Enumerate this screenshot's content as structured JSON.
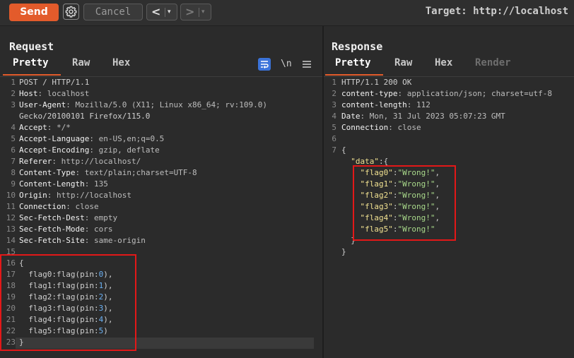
{
  "toolbar": {
    "send_label": "Send",
    "cancel_label": "Cancel",
    "back_glyph": "<",
    "forward_glyph": ">",
    "dropdown_glyph": "▾",
    "target_label": "Target: http://localhost"
  },
  "request": {
    "title": "Request",
    "tabs": [
      "Pretty",
      "Raw",
      "Hex"
    ],
    "newline_toggle": "\\n",
    "lines": [
      {
        "num": "1",
        "key": "",
        "sep": "",
        "value": "POST / HTTP/1.1"
      },
      {
        "num": "2",
        "key": "Host",
        "sep": ": ",
        "value": "localhost"
      },
      {
        "num": "3",
        "key": "User-Agent",
        "sep": ": ",
        "value": "Mozilla/5.0 (X11; Linux x86_64; rv:109.0)"
      },
      {
        "num": "",
        "key": "",
        "sep": "",
        "value": "Gecko/20100101 Firefox/115.0"
      },
      {
        "num": "4",
        "key": "Accept",
        "sep": ": ",
        "value": "*/*"
      },
      {
        "num": "5",
        "key": "Accept-Language",
        "sep": ": ",
        "value": "en-US,en;q=0.5"
      },
      {
        "num": "6",
        "key": "Accept-Encoding",
        "sep": ": ",
        "value": "gzip, deflate"
      },
      {
        "num": "7",
        "key": "Referer",
        "sep": ": ",
        "value": "http://localhost/"
      },
      {
        "num": "8",
        "key": "Content-Type",
        "sep": ": ",
        "value": "text/plain;charset=UTF-8"
      },
      {
        "num": "9",
        "key": "Content-Length",
        "sep": ": ",
        "value": "135"
      },
      {
        "num": "10",
        "key": "Origin",
        "sep": ": ",
        "value": "http://localhost"
      },
      {
        "num": "11",
        "key": "Connection",
        "sep": ": ",
        "value": "close"
      },
      {
        "num": "12",
        "key": "Sec-Fetch-Dest",
        "sep": ": ",
        "value": "empty"
      },
      {
        "num": "13",
        "key": "Sec-Fetch-Mode",
        "sep": ": ",
        "value": "cors"
      },
      {
        "num": "14",
        "key": "Sec-Fetch-Site",
        "sep": ": ",
        "value": "same-origin"
      },
      {
        "num": "15",
        "key": "",
        "sep": "",
        "value": ""
      },
      {
        "num": "16",
        "key": "",
        "sep": "",
        "value": "{"
      },
      {
        "num": "17",
        "key": "",
        "sep": "",
        "value": "  flag0:flag(pin:",
        "n": "0",
        "end": "),"
      },
      {
        "num": "18",
        "key": "",
        "sep": "",
        "value": "  flag1:flag(pin:",
        "n": "1",
        "end": "),"
      },
      {
        "num": "19",
        "key": "",
        "sep": "",
        "value": "  flag2:flag(pin:",
        "n": "2",
        "end": "),"
      },
      {
        "num": "20",
        "key": "",
        "sep": "",
        "value": "  flag3:flag(pin:",
        "n": "3",
        "end": "),"
      },
      {
        "num": "21",
        "key": "",
        "sep": "",
        "value": "  flag4:flag(pin:",
        "n": "4",
        "end": "),"
      },
      {
        "num": "22",
        "key": "",
        "sep": "",
        "value": "  flag5:flag(pin:",
        "n": "5",
        "end": ")"
      },
      {
        "num": "23",
        "key": "",
        "sep": "",
        "value": "}"
      }
    ]
  },
  "response": {
    "title": "Response",
    "tabs": [
      "Pretty",
      "Raw",
      "Hex",
      "Render"
    ],
    "lines": [
      {
        "num": "1",
        "key": "",
        "sep": "",
        "value": "HTTP/1.1 200 OK"
      },
      {
        "num": "2",
        "key": "content-type",
        "sep": ": ",
        "value": "application/json; charset=utf-8"
      },
      {
        "num": "3",
        "key": "content-length",
        "sep": ": ",
        "value": "112"
      },
      {
        "num": "4",
        "key": "Date",
        "sep": ": ",
        "value": "Mon, 31 Jul 2023 05:07:23 GMT"
      },
      {
        "num": "5",
        "key": "Connection",
        "sep": ": ",
        "value": "close"
      },
      {
        "num": "6",
        "key": "",
        "sep": "",
        "value": ""
      },
      {
        "num": "7",
        "key": "",
        "sep": "",
        "value": "{"
      },
      {
        "num": "",
        "jkey": "  \"data\"",
        "after": ":{"
      },
      {
        "num": "",
        "jkey": "    \"flag0\"",
        "colon": ":",
        "jstr": "\"Wrong!\"",
        "after": ","
      },
      {
        "num": "",
        "jkey": "    \"flag1\"",
        "colon": ":",
        "jstr": "\"Wrong!\"",
        "after": ","
      },
      {
        "num": "",
        "jkey": "    \"flag2\"",
        "colon": ":",
        "jstr": "\"Wrong!\"",
        "after": ","
      },
      {
        "num": "",
        "jkey": "    \"flag3\"",
        "colon": ":",
        "jstr": "\"Wrong!\"",
        "after": ","
      },
      {
        "num": "",
        "jkey": "    \"flag4\"",
        "colon": ":",
        "jstr": "\"Wrong!\"",
        "after": ","
      },
      {
        "num": "",
        "jkey": "    \"flag5\"",
        "colon": ":",
        "jstr": "\"Wrong!\"",
        "after": ""
      },
      {
        "num": "",
        "value": "  }"
      },
      {
        "num": "",
        "value": "}"
      }
    ]
  },
  "colors": {
    "accent": "#e35b2b",
    "highlight_box": "#e31818",
    "number": "#6ab0f3",
    "json_key": "#f0e090",
    "json_string": "#a8d88a"
  }
}
